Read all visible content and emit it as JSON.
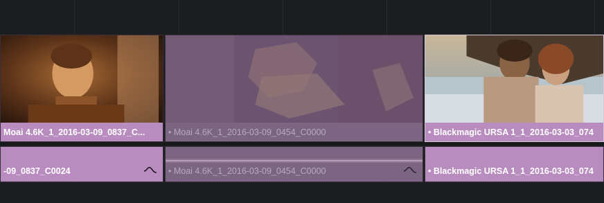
{
  "timeline": {
    "video_track": {
      "clips": [
        {
          "label": "Moai 4.6K_1_2016-03-09_0837_C...",
          "state": "normal",
          "thumbnail": "boy-face-warm-light"
        },
        {
          "label": "• Moai 4.6K_1_2016-03-09_0454_C0000",
          "state": "disabled",
          "thumbnail": "hands-with-fabric"
        },
        {
          "label": "• Blackmagic URSA 1_1_2016-03-03_074",
          "state": "selected",
          "thumbnail": "couple-on-beach"
        }
      ]
    },
    "audio_track": {
      "clips": [
        {
          "label": "-09_0837_C0024",
          "state": "normal",
          "icon": "curve-icon"
        },
        {
          "label": "• Moai 4.6K_1_2016-03-09_0454_C0000",
          "state": "disabled",
          "icon": "curve-icon"
        },
        {
          "label": "• Blackmagic URSA 1_1_2016-03-03_074",
          "state": "normal",
          "icon": null
        }
      ]
    },
    "colors": {
      "background": "#1e1f21",
      "clip_purple": "#b98cbf",
      "clip_purple_dim": "#7c6483",
      "clip_border": "#3a2e3d",
      "selected_border": "#d8c6dc"
    }
  }
}
